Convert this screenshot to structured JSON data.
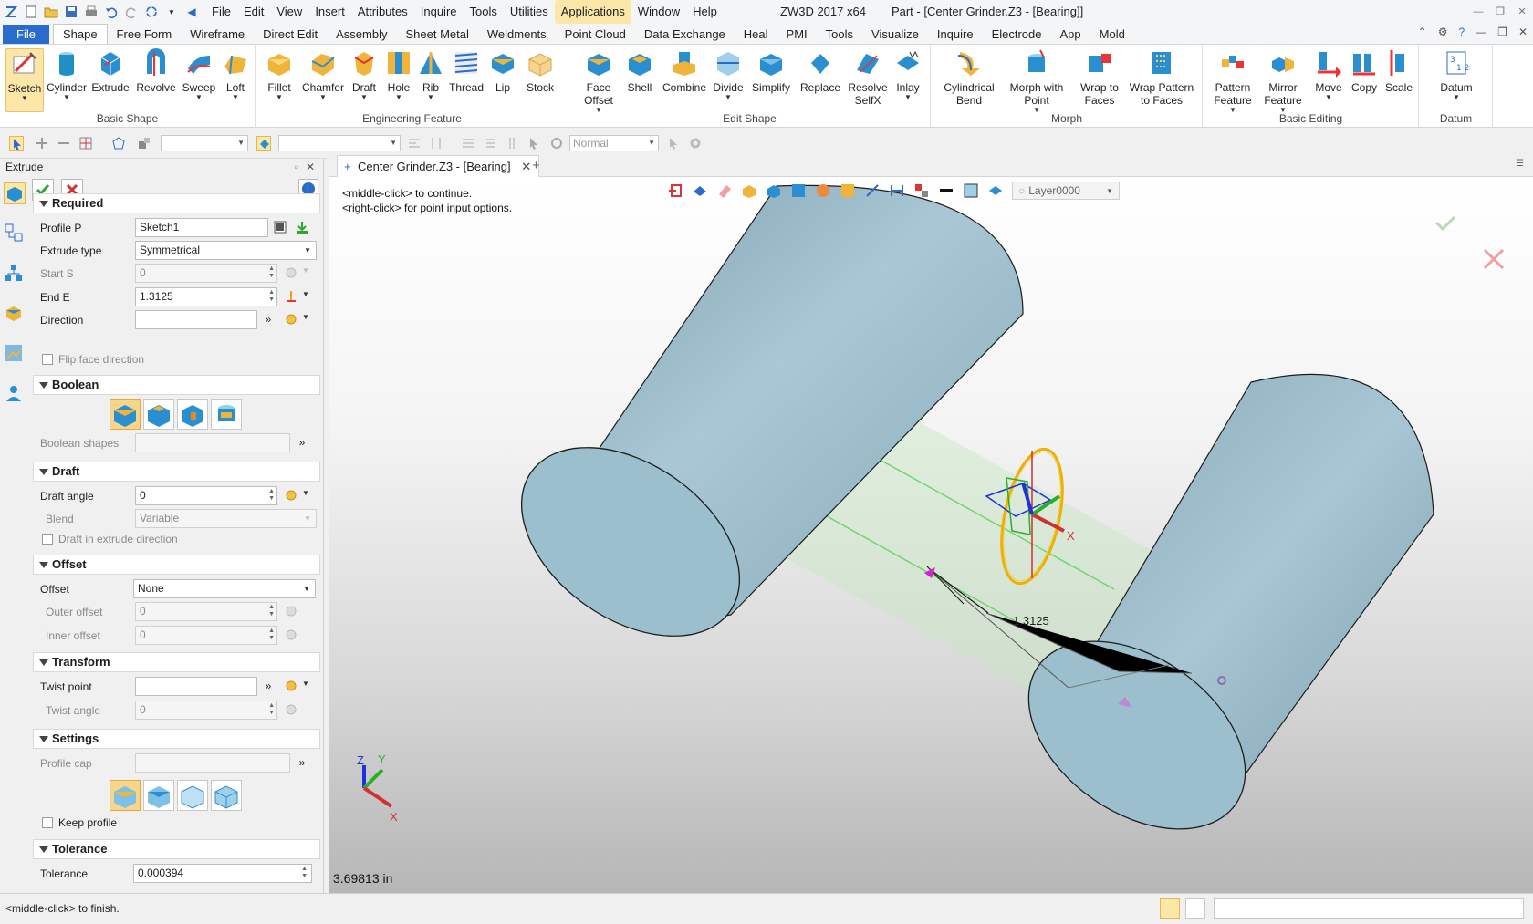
{
  "app": {
    "title": "ZW3D 2017  x64",
    "document_title": "Part - [Center Grinder.Z3 - [Bearing]]",
    "menu": [
      "File",
      "Edit",
      "View",
      "Insert",
      "Attributes",
      "Inquire",
      "Tools",
      "Utilities",
      "Applications",
      "Window",
      "Help"
    ]
  },
  "ribbon_tabs": [
    "File",
    "Shape",
    "Free Form",
    "Wireframe",
    "Direct Edit",
    "Assembly",
    "Sheet Metal",
    "Weldments",
    "Point Cloud",
    "Data Exchange",
    "Heal",
    "PMI",
    "Tools",
    "Visualize",
    "Inquire",
    "Electrode",
    "App",
    "Mold"
  ],
  "ribbon": {
    "basic_shape": {
      "label": "Basic Shape",
      "buttons": [
        "Sketch",
        "Cylinder",
        "Extrude",
        "Revolve",
        "Sweep",
        "Loft"
      ]
    },
    "engineering_feature": {
      "label": "Engineering Feature",
      "buttons": [
        "Fillet",
        "Chamfer",
        "Draft",
        "Hole",
        "Rib",
        "Thread",
        "Lip",
        "Stock"
      ]
    },
    "edit_shape": {
      "label": "Edit Shape",
      "buttons": [
        "Face Offset",
        "Shell",
        "Combine",
        "Divide",
        "Simplify",
        "Replace",
        "Resolve SelfX",
        "Inlay"
      ]
    },
    "morph": {
      "label": "Morph",
      "buttons": [
        "Cylindrical Bend",
        "Morph with Point",
        "Wrap to Faces",
        "Wrap Pattern to Faces"
      ]
    },
    "basic_editing": {
      "label": "Basic Editing",
      "buttons": [
        "Pattern Feature",
        "Mirror Feature",
        "Move",
        "Copy",
        "Scale"
      ]
    },
    "datum": {
      "label": "Datum",
      "buttons": [
        "Datum"
      ]
    }
  },
  "toolbar2": {
    "filter_value": "Normal"
  },
  "panel": {
    "title": "Extrude",
    "required": {
      "header": "Required",
      "profile_label": "Profile P",
      "profile_value": "Sketch1",
      "extrude_type_label": "Extrude type",
      "extrude_type_value": "Symmetrical",
      "start_label": "Start S",
      "start_value": "0",
      "end_label": "End E",
      "end_value": "1.3125",
      "direction_label": "Direction",
      "direction_value": "",
      "flip_label": "Flip face direction"
    },
    "boolean": {
      "header": "Boolean",
      "shapes_label": "Boolean shapes"
    },
    "draft": {
      "header": "Draft",
      "angle_label": "Draft angle",
      "angle_value": "0",
      "blend_label": "Blend",
      "blend_value": "Variable",
      "in_direction_label": "Draft in extrude direction"
    },
    "offset": {
      "header": "Offset",
      "offset_label": "Offset",
      "offset_value": "None",
      "outer_label": "Outer offset",
      "outer_value": "0",
      "inner_label": "Inner offset",
      "inner_value": "0"
    },
    "transform": {
      "header": "Transform",
      "twist_point_label": "Twist point",
      "twist_point_value": "",
      "twist_angle_label": "Twist angle",
      "twist_angle_value": "0"
    },
    "settings": {
      "header": "Settings",
      "profile_cap_label": "Profile cap",
      "keep_profile_label": "Keep profile"
    },
    "tolerance": {
      "header": "Tolerance",
      "label": "Tolerance",
      "value": "0.000394"
    }
  },
  "doc_tab": {
    "label": "Center Grinder.Z3 - [Bearing]"
  },
  "viewport": {
    "hint_line1": "<middle-click> to continue.",
    "hint_line2": "<right-click> for point input options.",
    "layer": "Layer0000",
    "dimension_label": "1.3125",
    "measure": "3.69813 in",
    "axis_x": "X",
    "axis_y": "Y",
    "axis_z": "Z"
  },
  "status": {
    "message": "<middle-click> to finish."
  },
  "colors": {
    "accent": "#2a6ccc",
    "highlight": "#fbe7a8",
    "cylinder": "#9cbfce",
    "cylinder_dark": "#7e9fb0"
  }
}
